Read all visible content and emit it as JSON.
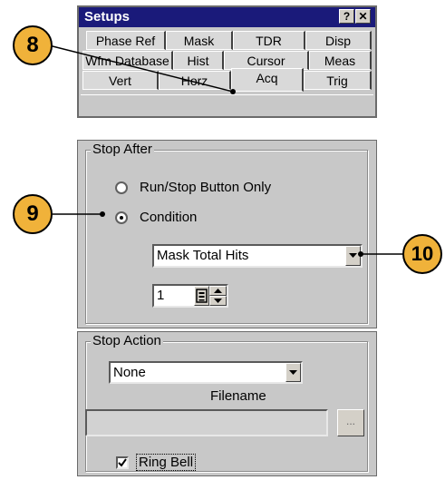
{
  "setups": {
    "title": "Setups",
    "help_label": "?",
    "close_label": "✕",
    "tabs_row1": [
      "Phase Ref",
      "Mask",
      "TDR",
      "Disp"
    ],
    "tabs_row2": [
      "Wfm Database",
      "Hist",
      "Cursor",
      "Meas"
    ],
    "tabs_row3": [
      "Vert",
      "Horz",
      "Acq",
      "Trig"
    ],
    "active_tab": "Acq"
  },
  "stop_after": {
    "legend": "Stop After",
    "radio_run_stop": "Run/Stop Button Only",
    "radio_condition": "Condition",
    "selected": "Condition",
    "condition_value": "Mask Total Hits",
    "count_value": "1"
  },
  "stop_action": {
    "legend": "Stop Action",
    "action_value": "None",
    "filename_label": "Filename",
    "filename_value": "",
    "browse_label": "...",
    "ring_bell_label": "Ring Bell",
    "ring_bell_checked": true
  },
  "callouts": [
    "8",
    "9",
    "10"
  ],
  "colors": {
    "titlebar": "#1a1a7a",
    "callout": "#f0b23a",
    "panel": "#c8c8c8"
  }
}
